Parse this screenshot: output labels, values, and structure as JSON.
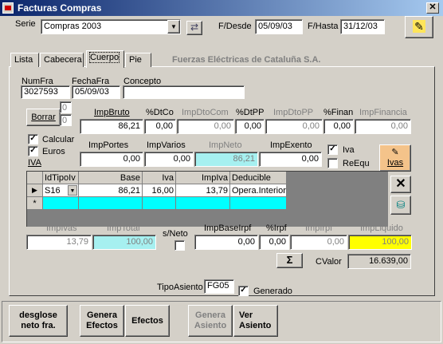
{
  "window": {
    "title": "Facturas Compras"
  },
  "serie": {
    "label": "Serie",
    "value": "Compras 2003"
  },
  "dates": {
    "desde_label": "F/Desde",
    "desde_value": "05/09/03",
    "hasta_label": "F/Hasta",
    "hasta_value": "31/12/03"
  },
  "tabs": {
    "lista": "Lista",
    "cabecera": "Cabecera",
    "cuerpo": "Cuerpo",
    "pie": "Pie"
  },
  "company": "Fuerzas Eléctricas de Cataluña S.A.",
  "header": {
    "numfra_label": "NumFra",
    "numfra_value": "3027593",
    "fechafra_label": "FechaFra",
    "fechafra_value": "05/09/03",
    "concepto_label": "Concepto",
    "concepto_value": ""
  },
  "borrar": {
    "label": "Borrar",
    "count1": "0",
    "count2": "0"
  },
  "row1": {
    "impbruto_label": "ImpBruto",
    "impbruto": "86,21",
    "dtco_label": "%DtCo",
    "dtco": "0,00",
    "impdtocom_label": "ImpDtoCom",
    "impdtocom": "0,00",
    "dtpp_label": "%DtPP",
    "dtpp": "0,00",
    "impdtopp_label": "ImpDtoPP",
    "impdtopp": "0,00",
    "finan_label": "%Finan",
    "finan": "0,00",
    "impfinanciacion_label": "ImpFinancia",
    "impfinanciacion": "0,00"
  },
  "checks": {
    "calcular": "Calcular",
    "euros": "Euros",
    "iva_label": "IVA"
  },
  "row2": {
    "impportes_label": "ImpPortes",
    "impportes": "0,00",
    "impvarios_label": "ImpVarios",
    "impvarios": "0,00",
    "impneto_label": "ImpNeto",
    "impneto": "86,21",
    "impexento_label": "ImpExento",
    "impexento": "0,00"
  },
  "ivaopts": {
    "iva": "Iva",
    "reequ": "ReEqu",
    "ivas_button": "Ivas"
  },
  "grid": {
    "headers": [
      "IdTipoIv",
      "Base",
      "Iva",
      "ImpIva",
      "Deducible"
    ],
    "rows": [
      {
        "tipo": "S16",
        "base": "86,21",
        "iva": "16,00",
        "impiva": "13,79",
        "deducible": "Opera.Interiore"
      }
    ],
    "new_marker": "*",
    "current_marker": "▶"
  },
  "totals": {
    "impivas_label": "ImpIvas",
    "impivas": "13,79",
    "imptotal_label": "ImpTotal",
    "imptotal": "100,00",
    "sneto_label": "s/Neto",
    "impbaseirpf_label": "ImpBaseIrpf",
    "impbaseirpf": "0,00",
    "irpf_label": "%Irpf",
    "irpf": "0,00",
    "impirpf_label": "ImpIrpf",
    "impirpf": "0,00",
    "impliquido_label": "ImpLiquido",
    "impliquido": "100,00",
    "sigma": "Σ",
    "cvalor_label": "CValor",
    "cvalor": "16.639,00"
  },
  "tipoasiento": {
    "label": "TipoAsiento",
    "value": "FG05",
    "generado": "Generado"
  },
  "buttons": {
    "desglose1": "desglose",
    "desglose2": "neto fra.",
    "genera_efectos1": "Genera",
    "genera_efectos2": "Efectos",
    "efectos": "Efectos",
    "genera_asiento1": "Genera",
    "genera_asiento2": "Asiento",
    "ver_asiento1": "Ver",
    "ver_asiento2": "Asiento"
  },
  "colors": {
    "cyan": "#00ffff",
    "light_cyan": "#a6f0f0",
    "yellow": "#ffff00",
    "orange": "#f4c38a",
    "title": "#0a246a"
  }
}
